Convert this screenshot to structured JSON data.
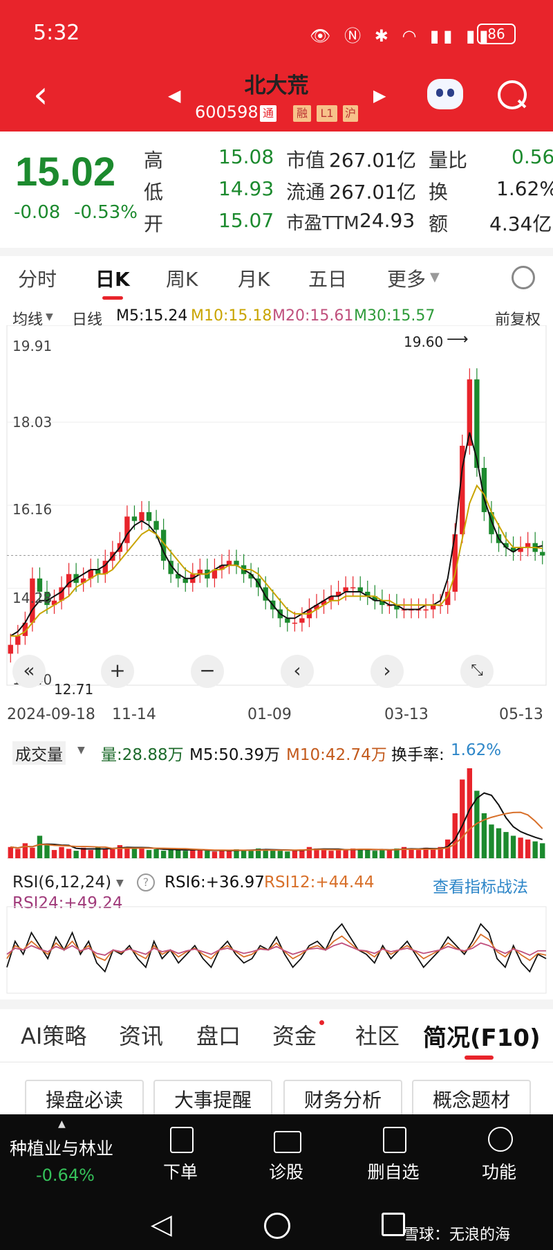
{
  "status_bar": {
    "time": "5:32",
    "battery": "86"
  },
  "header": {
    "title": "北大荒",
    "code": "600598",
    "tags": [
      "通",
      "融",
      "L1",
      "沪"
    ]
  },
  "quote": {
    "price": "15.02",
    "change": "-0.08",
    "change_pct": "-0.53%",
    "high_label": "高",
    "high": "15.08",
    "low_label": "低",
    "low": "14.93",
    "open_label": "开",
    "open": "15.07",
    "mktcap_label": "市值",
    "mktcap": "267.01亿",
    "float_label": "流通",
    "float": "267.01亿",
    "pe_label": "市盈TTM",
    "pe": "24.93",
    "volratio_label": "量比",
    "volratio": "0.56",
    "turnover_label": "换",
    "turnover": "1.62%",
    "amount_label": "额",
    "amount": "4.34亿"
  },
  "chart_tabs": [
    "分时",
    "日K",
    "周K",
    "月K",
    "五日",
    "更多"
  ],
  "kline_legend": {
    "ma_select": "均线",
    "period": "日线",
    "m5": "M5:15.24",
    "m10": "M10:15.18",
    "m20": "M20:15.61",
    "m30": "M30:15.57",
    "adjust": "前复权"
  },
  "colors": {
    "red": "#e8242b",
    "green": "#1c8a2e",
    "m5": "#111111",
    "m10": "#c9a400",
    "m20": "#c0507d",
    "m30": "#2e9b3a",
    "rsi_blue": "#2d86c8",
    "rsi12": "#d8702a"
  },
  "chart_data": [
    {
      "type": "candlestick",
      "title": "日K",
      "y_ticks": [
        "19.91",
        "18.03",
        "16.16",
        "14.28",
        "12.40"
      ],
      "ylim": [
        12.4,
        19.91
      ],
      "x_ticks": [
        "2024-09-18",
        "11-14",
        "01-09",
        "03-13",
        "05-13"
      ],
      "max_label": "19.60",
      "min_label": "12.71",
      "series": [
        {
          "name": "收盘",
          "values": [
            13.0,
            13.2,
            13.5,
            14.5,
            14.2,
            13.9,
            14.0,
            14.3,
            14.6,
            14.4,
            14.5,
            14.7,
            14.6,
            14.9,
            15.1,
            15.3,
            15.9,
            15.8,
            16.0,
            15.8,
            15.6,
            14.9,
            14.6,
            14.5,
            14.4,
            14.6,
            14.7,
            14.5,
            14.7,
            14.8,
            14.9,
            14.8,
            14.6,
            14.5,
            14.3,
            14.0,
            13.8,
            13.6,
            13.5,
            13.5,
            13.6,
            13.8,
            13.9,
            14.0,
            14.1,
            14.2,
            14.3,
            14.3,
            14.2,
            14.1,
            14.0,
            13.9,
            13.9,
            13.8,
            13.8,
            13.8,
            13.8,
            13.8,
            13.9,
            13.9,
            14.2,
            15.5,
            17.5,
            19.0,
            17.0,
            16.0,
            15.5,
            15.3,
            15.2,
            15.1,
            15.2,
            15.3,
            15.1,
            15.02
          ]
        },
        {
          "name": "M5",
          "values": [
            13.2,
            13.3,
            13.5,
            13.8,
            14.0,
            14.0,
            14.1,
            14.2,
            14.4,
            14.5,
            14.6,
            14.7,
            14.7,
            14.8,
            15.0,
            15.2,
            15.5,
            15.7,
            15.8,
            15.7,
            15.5,
            15.1,
            14.8,
            14.6,
            14.5,
            14.5,
            14.6,
            14.6,
            14.7,
            14.8,
            14.8,
            14.8,
            14.7,
            14.6,
            14.4,
            14.1,
            13.9,
            13.7,
            13.6,
            13.6,
            13.7,
            13.8,
            13.9,
            14.0,
            14.1,
            14.1,
            14.2,
            14.2,
            14.2,
            14.1,
            14.0,
            14.0,
            13.9,
            13.9,
            13.8,
            13.8,
            13.8,
            13.9,
            13.9,
            14.0,
            14.5,
            15.5,
            17.0,
            17.8,
            17.2,
            16.3,
            15.8,
            15.4,
            15.2,
            15.1,
            15.2,
            15.2,
            15.2,
            15.24
          ]
        },
        {
          "name": "M10",
          "values": [
            13.2,
            13.2,
            13.3,
            13.5,
            13.7,
            13.8,
            13.9,
            14.0,
            14.1,
            14.3,
            14.4,
            14.5,
            14.6,
            14.6,
            14.7,
            14.9,
            15.1,
            15.3,
            15.5,
            15.6,
            15.5,
            15.3,
            15.1,
            14.9,
            14.7,
            14.6,
            14.6,
            14.6,
            14.7,
            14.7,
            14.8,
            14.8,
            14.7,
            14.7,
            14.6,
            14.4,
            14.2,
            14.0,
            13.8,
            13.7,
            13.7,
            13.7,
            13.8,
            13.9,
            14.0,
            14.0,
            14.1,
            14.1,
            14.1,
            14.1,
            14.1,
            14.0,
            14.0,
            13.9,
            13.9,
            13.9,
            13.9,
            13.9,
            13.9,
            13.9,
            14.1,
            14.6,
            15.4,
            16.2,
            16.6,
            16.4,
            16.0,
            15.7,
            15.4,
            15.2,
            15.2,
            15.2,
            15.2,
            15.18
          ]
        }
      ]
    },
    {
      "type": "bar",
      "title": "成交量",
      "legend": {
        "label": "成交量",
        "vol": "量:28.88万",
        "m5": "M5:50.39万",
        "m10": "M10:42.74万",
        "turnover_label": "换手率:",
        "turnover": "1.62%"
      },
      "values": [
        30,
        25,
        40,
        28,
        60,
        35,
        22,
        30,
        25,
        20,
        28,
        22,
        30,
        26,
        24,
        35,
        30,
        28,
        26,
        22,
        24,
        20,
        26,
        22,
        20,
        24,
        22,
        20,
        18,
        22,
        20,
        24,
        22,
        20,
        26,
        24,
        22,
        20,
        18,
        22,
        24,
        30,
        26,
        22,
        20,
        24,
        22,
        26,
        24,
        22,
        20,
        24,
        22,
        26,
        30,
        24,
        22,
        28,
        24,
        30,
        50,
        120,
        210,
        240,
        180,
        120,
        90,
        80,
        70,
        60,
        55,
        50,
        45,
        40
      ]
    },
    {
      "type": "line",
      "title": "RSI",
      "legend": {
        "select": "RSI(6,12,24)",
        "rsi6": "RSI6:+36.97",
        "rsi12": "RSI12:+44.44",
        "rsi24": "RSI24:+49.24",
        "link": "查看指标战法"
      },
      "series": [
        {
          "name": "RSI6",
          "values": [
            30,
            60,
            45,
            70,
            55,
            40,
            65,
            50,
            70,
            45,
            60,
            35,
            25,
            50,
            45,
            55,
            40,
            30,
            60,
            40,
            50,
            35,
            45,
            55,
            40,
            30,
            50,
            60,
            45,
            35,
            40,
            55,
            50,
            65,
            45,
            30,
            40,
            55,
            60,
            50,
            70,
            80,
            65,
            50,
            45,
            35,
            55,
            40,
            50,
            60,
            45,
            30,
            40,
            50,
            65,
            55,
            45,
            60,
            80,
            70,
            40,
            30,
            55,
            35,
            25,
            45,
            40
          ]
        },
        {
          "name": "RSI12",
          "values": [
            40,
            55,
            50,
            60,
            52,
            45,
            58,
            50,
            60,
            48,
            55,
            42,
            38,
            50,
            47,
            52,
            45,
            40,
            55,
            45,
            50,
            42,
            48,
            52,
            45,
            40,
            50,
            55,
            48,
            42,
            45,
            52,
            50,
            58,
            48,
            40,
            45,
            52,
            55,
            50,
            60,
            66,
            58,
            50,
            48,
            42,
            52,
            45,
            50,
            55,
            48,
            40,
            45,
            50,
            58,
            52,
            48,
            55,
            68,
            62,
            48,
            42,
            52,
            44,
            38,
            46,
            44
          ]
        },
        {
          "name": "RSI24",
          "values": [
            45,
            52,
            50,
            55,
            51,
            48,
            54,
            50,
            55,
            49,
            52,
            46,
            44,
            50,
            48,
            51,
            48,
            45,
            52,
            48,
            50,
            46,
            49,
            51,
            48,
            45,
            50,
            52,
            49,
            46,
            48,
            51,
            50,
            54,
            49,
            45,
            48,
            51,
            52,
            50,
            55,
            58,
            54,
            50,
            49,
            46,
            51,
            48,
            50,
            52,
            49,
            46,
            48,
            50,
            54,
            51,
            49,
            52,
            58,
            55,
            50,
            46,
            51,
            48,
            44,
            49,
            49
          ]
        }
      ]
    }
  ],
  "bottom_tabs": [
    "AI策略",
    "资讯",
    "盘口",
    "资金",
    "社区",
    "简况(F10)"
  ],
  "buttons": [
    "操盘必读",
    "大事提醒",
    "财务分析",
    "概念题材"
  ],
  "sector": {
    "name": "种植业与林业",
    "change": "-0.64%"
  },
  "bottom_nav": [
    "下单",
    "诊股",
    "删自选",
    "功能"
  ],
  "watermark": "雪球：无浪的海"
}
